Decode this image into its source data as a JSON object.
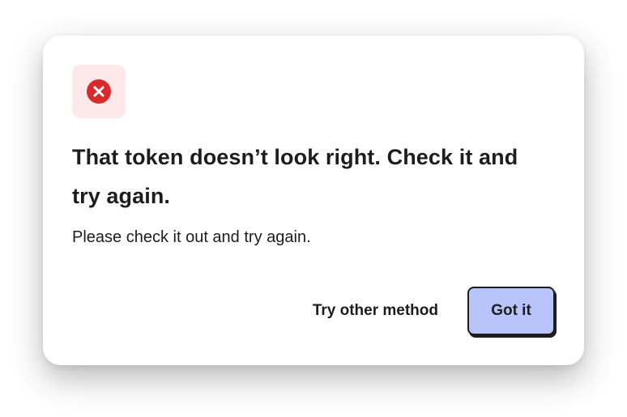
{
  "dialog": {
    "icon": "error-x-circle-icon",
    "icon_color": "#d92b2b",
    "icon_background": "#fde9ea",
    "title": "That token doesn’t look right. Check it and try again.",
    "message": "Please check it out and try again.",
    "secondary_action": "Try other method",
    "primary_action": "Got it",
    "primary_color": "#b9c4fb"
  }
}
